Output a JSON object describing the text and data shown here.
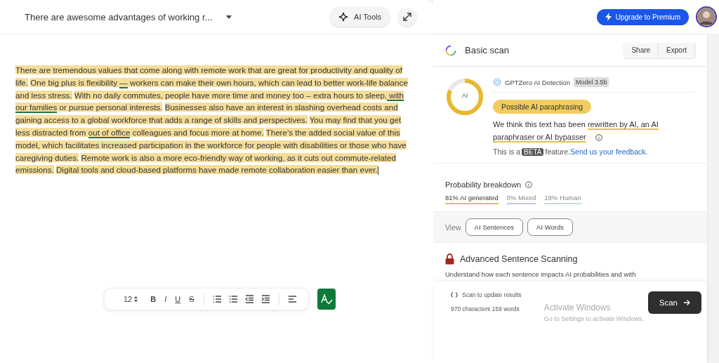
{
  "editor": {
    "doc_title": "There are awesome advantages of working r...",
    "ai_tools": "AI Tools",
    "sentences": [
      {
        "highlighted": true,
        "segments": [
          {
            "text": "There are tremendous values that come along with  remote work that are great for productivity and quality of life.",
            "underline": false
          }
        ]
      },
      {
        "highlighted": true,
        "segments": [
          {
            "text": "One big plus is flexibility ",
            "underline": false
          },
          {
            "text": "—",
            "underline": true
          },
          {
            "text": " workers can  make their own hours, which can lead to better work-life balance and less stress.",
            "underline": false
          }
        ]
      },
      {
        "highlighted": true,
        "segments": [
          {
            "text": "With no daily commutes, people  have more time and money too – extra hours to sleep,",
            "underline": false
          },
          {
            "text": " with our families",
            "underline": true
          },
          {
            "text": " or pursue personal interests.",
            "underline": false
          }
        ]
      },
      {
        "highlighted": true,
        "segments": [
          {
            "text": "Businesses also have an interest in slashing overhead  costs and gaining access to a global workforce that adds a range of skills and perspectives.",
            "underline": false
          }
        ]
      },
      {
        "highlighted": true,
        "segments": [
          {
            "text": "You may find that you get less distracted from ",
            "underline": false
          },
          {
            "text": "out of office",
            "underline": true
          },
          {
            "text": " colleagues and  focus more at home.",
            "underline": false
          }
        ]
      },
      {
        "highlighted": true,
        "segments": [
          {
            "text": "There’s the added social value of this model, which facilitates increased  participation in the workforce for people with disabilities or those who have caregiving duties.",
            "underline": false
          }
        ]
      },
      {
        "highlighted": true,
        "segments": [
          {
            "text": "Remote work is also  a more eco-friendly way of working, as it cuts out commute-related emissions.",
            "underline": false
          }
        ]
      },
      {
        "highlighted": true,
        "segments": [
          {
            "text": "Digital  tools and cloud-based platforms have made remote collaboration easier than ever.",
            "underline": false
          }
        ]
      }
    ],
    "toolbar": {
      "font_size": "12",
      "format_buttons": [
        {
          "kind": "bold",
          "label": "B"
        },
        {
          "kind": "italic",
          "label": "I"
        },
        {
          "kind": "underline",
          "label": "U"
        },
        {
          "kind": "strike",
          "label": "S"
        }
      ]
    }
  },
  "header": {
    "upgrade": "Upgrade to Premium"
  },
  "scan": {
    "title": "Basic scan",
    "actions": [
      "Share",
      "Export"
    ],
    "detector": "GPTZero AI Detection",
    "model": "Model 3.5b",
    "ring_label": "AI",
    "ring": {
      "level": 0.81
    },
    "verdict": "Possible AI paraphrasing",
    "explanation_start": "We think this text has been ",
    "explanation_link": "rewritten by AI, an AI paraphraser or AI bypasser",
    "beta_prefix": "This is a ",
    "beta": "BETA",
    "beta_suffix": " feature.",
    "feedback": "Send us your feedback.",
    "breakdown_title": "Probability breakdown",
    "breakdown": [
      {
        "label": "81% AI generated",
        "color": "#e6c24a",
        "selected": true
      },
      {
        "label": "0% Mixed",
        "color": "#c9c3e0",
        "selected": false
      },
      {
        "label": "19% Human",
        "color": "#bfe0d6",
        "selected": false
      }
    ],
    "view_label": "View",
    "view_buttons": [
      "AI Sentences",
      "AI Words"
    ],
    "advanced_title": "Advanced Sentence Scanning",
    "advanced_text": "Understand how each sentence impacts AI probabilities and with"
  },
  "footer": {
    "update": "Scan to update results",
    "counts": "970 characters 159 words",
    "scan_button": "Scan"
  },
  "os_notice": {
    "title": "Activate Windows",
    "subtitle": "Go to Settings to activate Windows."
  }
}
